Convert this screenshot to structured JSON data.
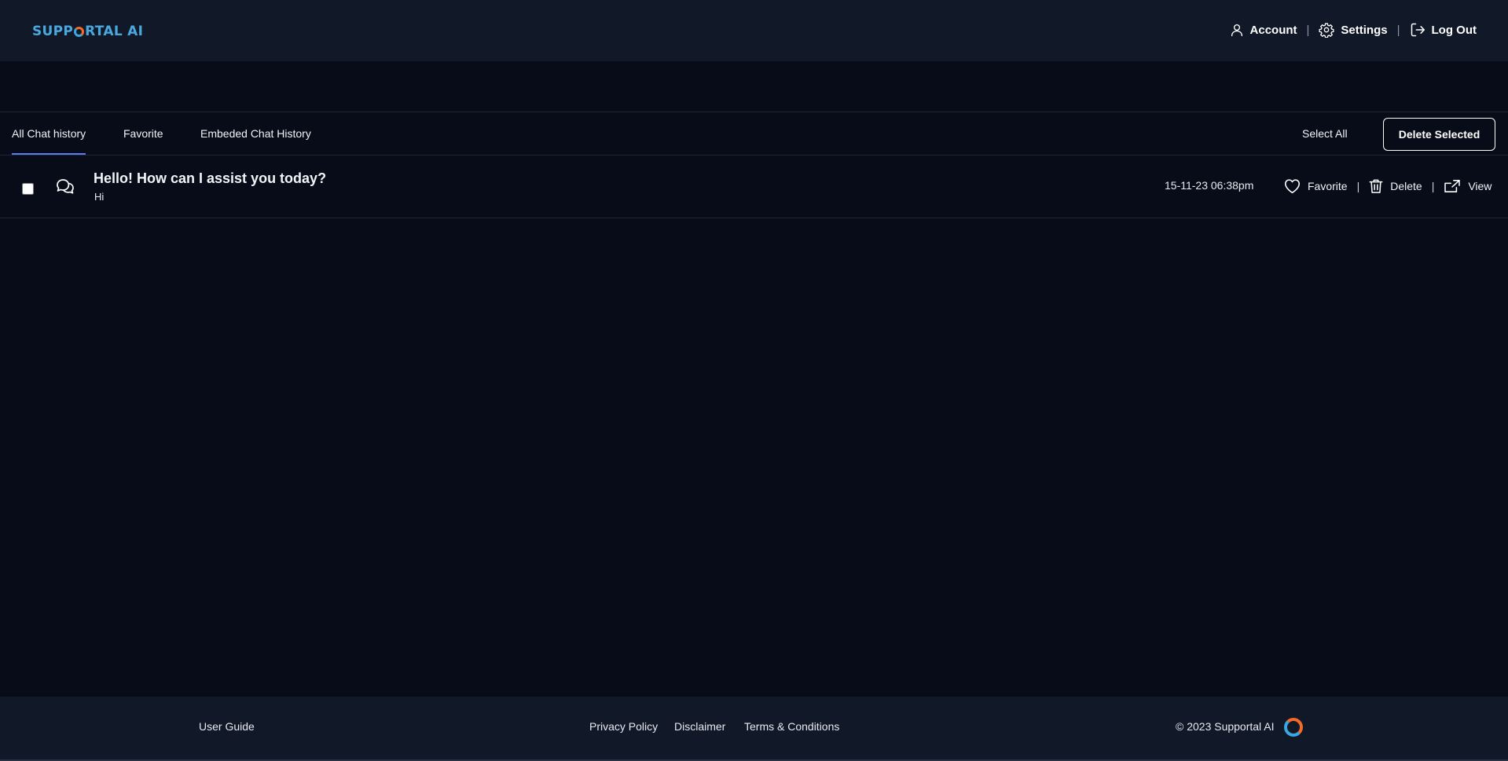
{
  "brand": {
    "logo_prefix": "SUPP",
    "logo_suffix": "RTAL AI",
    "logo_color": "#4aa8e0"
  },
  "header": {
    "account_label": "Account",
    "settings_label": "Settings",
    "logout_label": "Log Out",
    "separator": "|"
  },
  "tabs": [
    {
      "label": "All Chat history",
      "active": true
    },
    {
      "label": "Favorite",
      "active": false
    },
    {
      "label": "Embeded Chat History",
      "active": false
    }
  ],
  "toolbar": {
    "select_all_label": "Select All",
    "delete_selected_label": "Delete Selected"
  },
  "chats": [
    {
      "title": "Hello! How can I assist you today?",
      "preview": "Hi",
      "date": "15-11-23 06:38pm",
      "checked": false,
      "actions": {
        "favorite_label": "Favorite",
        "delete_label": "Delete",
        "view_label": "View"
      }
    }
  ],
  "footer": {
    "user_guide": "User Guide",
    "privacy_policy": "Privacy Policy",
    "disclaimer": "Disclaimer",
    "terms": "Terms & Conditions",
    "copyright": "©  2023 Supportal AI"
  },
  "colors": {
    "background": "#070c18",
    "header_bg": "#111827",
    "tab_active_underline": "#5b7cf0",
    "logo_orange": "#f26b2a",
    "logo_blue": "#3aa7e0"
  },
  "icons": [
    "user-icon",
    "gear-icon",
    "logout-icon",
    "chat-bubbles-icon",
    "heart-icon",
    "trash-icon",
    "share-icon",
    "supportal-logo-icon"
  ]
}
